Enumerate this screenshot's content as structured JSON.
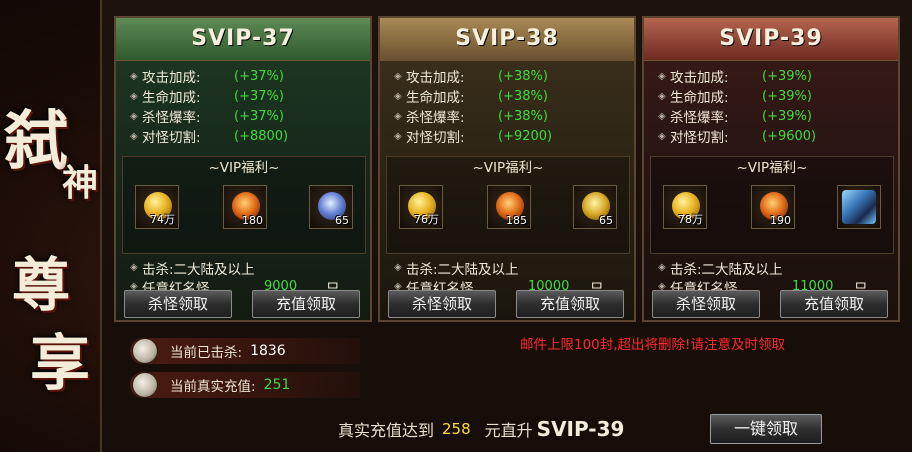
{
  "side_title": {
    "chars": [
      "弑",
      "神",
      "尊",
      "享"
    ]
  },
  "cards": [
    {
      "title": "SVIP-37",
      "stats": [
        {
          "label": "攻击加成:",
          "value": "(+37%)"
        },
        {
          "label": "生命加成:",
          "value": "(+37%)"
        },
        {
          "label": "杀怪爆率:",
          "value": "(+37%)"
        },
        {
          "label": "对怪切割:",
          "value": "(+8800)"
        }
      ],
      "welfare_title": "~VIP福利~",
      "items": [
        {
          "icon": "gold-coins-icon",
          "count": "74万"
        },
        {
          "icon": "fire-orb-icon",
          "count": "180"
        },
        {
          "icon": "blue-seal-icon",
          "count": "65"
        }
      ],
      "kill_label": "击杀:二大陆及以上",
      "boss_label": "任意红名怪",
      "boss_count": "9000",
      "boss_unit": "只",
      "btn_kill": "杀怪领取",
      "btn_recharge": "充值领取"
    },
    {
      "title": "SVIP-38",
      "stats": [
        {
          "label": "攻击加成:",
          "value": "(+38%)"
        },
        {
          "label": "生命加成:",
          "value": "(+38%)"
        },
        {
          "label": "杀怪爆率:",
          "value": "(+38%)"
        },
        {
          "label": "对怪切割:",
          "value": "(+9200)"
        }
      ],
      "welfare_title": "~VIP福利~",
      "items": [
        {
          "icon": "gold-coins-icon",
          "count": "76万"
        },
        {
          "icon": "fire-orb-icon",
          "count": "185"
        },
        {
          "icon": "gold-medal-icon",
          "count": "65"
        }
      ],
      "kill_label": "击杀:二大陆及以上",
      "boss_label": "任意红名怪",
      "boss_count": "10000",
      "boss_unit": "只",
      "btn_kill": "杀怪领取",
      "btn_recharge": "充值领取"
    },
    {
      "title": "SVIP-39",
      "stats": [
        {
          "label": "攻击加成:",
          "value": "(+39%)"
        },
        {
          "label": "生命加成:",
          "value": "(+39%)"
        },
        {
          "label": "杀怪爆率:",
          "value": "(+39%)"
        },
        {
          "label": "对怪切割:",
          "value": "(+9600)"
        }
      ],
      "welfare_title": "~VIP福利~",
      "items": [
        {
          "icon": "gold-coins-icon",
          "count": "78万"
        },
        {
          "icon": "fire-orb-icon",
          "count": "190"
        },
        {
          "icon": "warrior-figure-icon",
          "count": ""
        }
      ],
      "kill_label": "击杀:二大陆及以上",
      "boss_label": "任意红名怪",
      "boss_count": "11000",
      "boss_unit": "只",
      "btn_kill": "杀怪领取",
      "btn_recharge": "充值领取"
    }
  ],
  "mail_notice": "邮件上限100封,超出将删除!请注意及时领取",
  "current_kills": {
    "label": "当前已击杀:",
    "value": "1836"
  },
  "current_recharge": {
    "label": "当前真实充值:",
    "value": "251"
  },
  "bottom": {
    "prefix": "真实充值达到",
    "amount": "258",
    "mid": "元直升",
    "target": "SVIP-39",
    "button": "一键领取"
  }
}
